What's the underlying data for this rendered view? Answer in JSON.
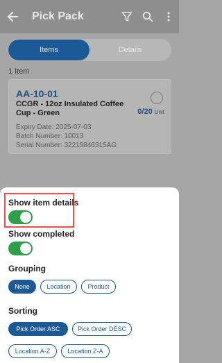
{
  "appbar": {
    "title": "Pick Pack",
    "icons": [
      "back-arrow-icon",
      "filter-icon",
      "search-icon",
      "more-vert-icon"
    ]
  },
  "tabs": [
    {
      "label": "Items",
      "active": true
    },
    {
      "label": "Details",
      "active": false
    }
  ],
  "item_count": "1 Item",
  "item": {
    "location": "AA-10-01",
    "description": "CCGR - 12oz Insulated Coffee Cup - Green",
    "expiry": "Expiry Date: 2025-07-03",
    "batch": "Batch Number: 10013",
    "serial": "Serial Number: 32215846315AG",
    "qty": "0/20",
    "unit": "Unit"
  },
  "settings": {
    "show_item_details": {
      "label": "Show item details",
      "on": true
    },
    "show_completed": {
      "label": "Show completed",
      "on": true
    },
    "grouping": {
      "label": "Grouping",
      "options": [
        "None",
        "Location",
        "Product"
      ],
      "selected": "None"
    },
    "sorting": {
      "label": "Sorting",
      "options": [
        "Pick Order ASC",
        "Pick Order DESC",
        "Location A-Z",
        "Location Z-A"
      ],
      "selected": "Pick Order ASC"
    }
  },
  "colors": {
    "primary": "#1b5a97",
    "toggle_on": "#2e9e47",
    "highlight": "#e5534b"
  }
}
